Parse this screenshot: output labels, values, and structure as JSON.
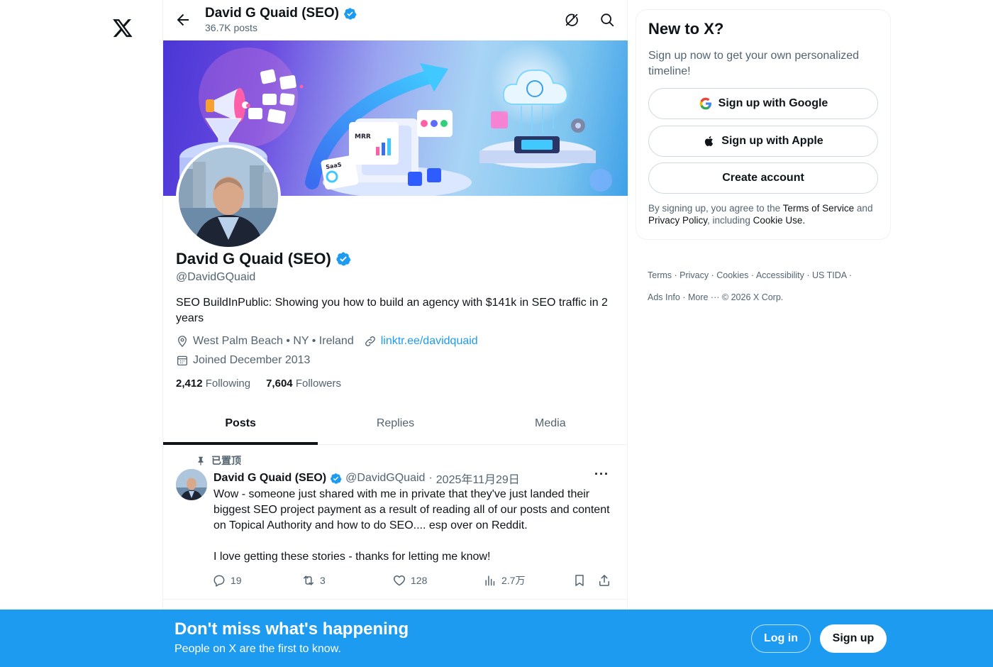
{
  "header": {
    "name": "David G Quaid (SEO)",
    "posts_count": "36.7K posts"
  },
  "profile": {
    "name": "David G Quaid (SEO)",
    "handle": "@DavidGQuaid",
    "bio": "SEO BuildInPublic: Showing you how to build an agency with $141k in SEO traffic in 2 years",
    "location": "West Palm Beach • NY • Ireland",
    "website": "linktr.ee/davidquaid",
    "joined": "Joined December 2013",
    "following_count": "2,412",
    "following_label": "Following",
    "followers_count": "7,604",
    "followers_label": "Followers"
  },
  "tabs": [
    {
      "label": "Posts",
      "active": true
    },
    {
      "label": "Replies",
      "active": false
    },
    {
      "label": "Media",
      "active": false
    }
  ],
  "tweet": {
    "pinned_label": "已置顶",
    "author_name": "David G Quaid (SEO)",
    "author_handle": "@DavidGQuaid",
    "separator": "·",
    "date": "2025年11月29日",
    "more": "···",
    "text": "Wow - someone just shared with me in private that they've just landed their biggest SEO project payment as a result of reading all of our posts and content on Topical Authority and how to do SEO.... esp over on Reddit.\n\nI love getting these stories - thanks for letting me know!",
    "replies": "19",
    "reposts": "3",
    "likes": "128",
    "views": "2.7万"
  },
  "banner_text": {
    "mrr": "MRR",
    "saas": "SaaS"
  },
  "signup_card": {
    "title": "New to X?",
    "subtitle": "Sign up now to get your own personalized timeline!",
    "google_label": "Sign up with Google",
    "apple_label": "Sign up with Apple",
    "create_label": "Create account",
    "legal_prefix": "By signing up, you agree to the ",
    "terms": "Terms of Service",
    "legal_and": " and ",
    "privacy": "Privacy Policy",
    "legal_including": ", including ",
    "cookie": "Cookie Use."
  },
  "footer": {
    "links": [
      "Terms",
      "Privacy",
      "Cookies",
      "Accessibility",
      "US TIDA",
      "Ads Info",
      "More ···"
    ],
    "copyright": "© 2026 X Corp."
  },
  "bottom_bar": {
    "title": "Don't miss what's happening",
    "subtitle": "People on X are the first to know.",
    "login": "Log in",
    "signup": "Sign up"
  },
  "colors": {
    "accent": "#1d9bf0",
    "text_primary": "#0f1419",
    "text_secondary": "#536471",
    "border": "#eff3f4"
  }
}
